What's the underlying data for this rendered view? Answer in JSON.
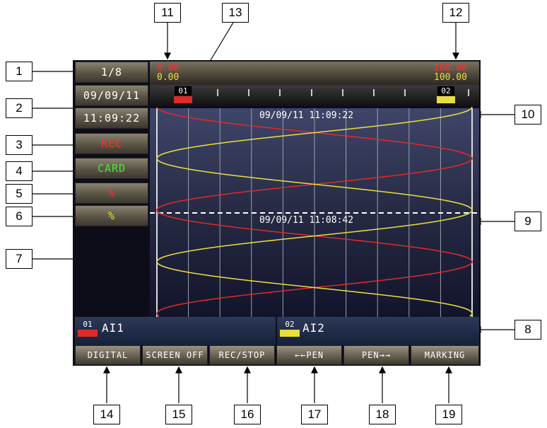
{
  "callouts": {
    "c1": "1",
    "c2": "2",
    "c3": "3",
    "c4": "4",
    "c5": "5",
    "c6": "6",
    "c7": "7",
    "c8": "8",
    "c9": "9",
    "c10": "10",
    "c11": "11",
    "c12": "12",
    "c13": "13",
    "c14": "14",
    "c15": "15",
    "c16": "16",
    "c17": "17",
    "c18": "18",
    "c19": "19"
  },
  "left_panel": {
    "page": "1/8",
    "date": "09/09/11",
    "time": "11:09:22",
    "rec": "REC",
    "card": "CARD",
    "pct_red": "%",
    "pct_yellow": "%"
  },
  "scale": {
    "left_min_red": "0.00",
    "left_min_yellow": "0.00",
    "right_max_red": "100.00",
    "right_max_yellow": "100.00"
  },
  "ruler": {
    "pen1_tag": "01",
    "pen2_tag": "02"
  },
  "chart": {
    "timestamp_top": "09/09/11 11:09:22",
    "timestamp_mark": "09/09/11 11:08:42"
  },
  "channels": {
    "ch1_tag": "01",
    "ch1_name": "AI1",
    "ch2_tag": "02",
    "ch2_name": "AI2"
  },
  "function_buttons": {
    "b14": "DIGITAL",
    "b15": "SCREEN OFF",
    "b16": "REC/STOP",
    "b17": "←←PEN",
    "b18": "PEN→→",
    "b19": "MARKING"
  },
  "colors": {
    "pen1": "#e02a2a",
    "pen2": "#e8df3c",
    "rec_text": "#ff3030",
    "card_text": "#50e040"
  }
}
